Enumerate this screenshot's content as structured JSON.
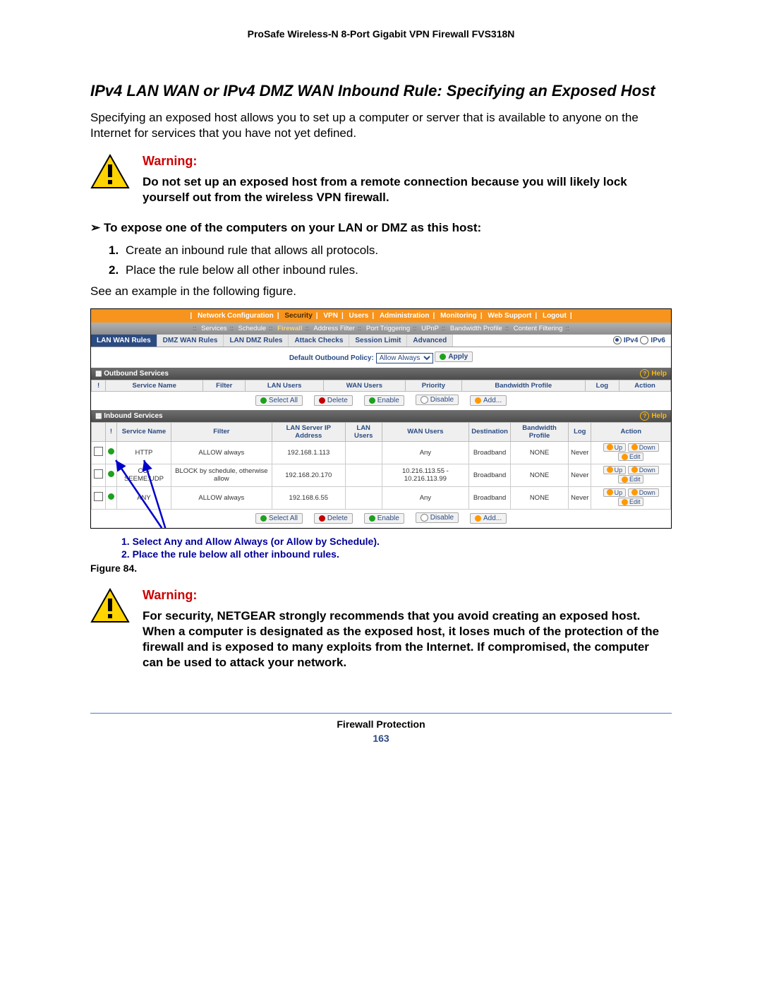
{
  "doc_header": "ProSafe Wireless-N 8-Port Gigabit VPN Firewall FVS318N",
  "section_title": "IPv4 LAN WAN or IPv4 DMZ WAN Inbound Rule: Specifying an Exposed Host",
  "intro": "Specifying an exposed host allows you to set up a computer or server that is available to anyone on the Internet for services that you have not yet defined.",
  "warning_label": "Warning:",
  "warning1_body": "Do not set up an exposed host from a remote connection because you will likely lock yourself out from the wireless VPN firewall.",
  "procedure_head": "➢  To expose one of the computers on your LAN or DMZ as this host:",
  "steps": {
    "s1": "Create an inbound rule that allows all protocols.",
    "s2": "Place the rule below all other inbound rules."
  },
  "see_line": "See an example in the following figure.",
  "top_nav": {
    "items": [
      "Network Configuration",
      "Security",
      "VPN",
      "Users",
      "Administration",
      "Monitoring",
      "Web Support",
      "Logout"
    ],
    "active": "Security"
  },
  "sub_nav": {
    "items": [
      "Services",
      "Schedule",
      "Firewall",
      "Address Filter",
      "Port Triggering",
      "UPnP",
      "Bandwidth Profile",
      "Content Filtering"
    ],
    "active": "Firewall"
  },
  "tabs": {
    "items": [
      "LAN WAN Rules",
      "DMZ WAN Rules",
      "LAN DMZ Rules",
      "Attack Checks",
      "Session Limit",
      "Advanced"
    ],
    "active": "LAN WAN Rules"
  },
  "ip_mode": {
    "v4": "IPv4",
    "v6": "IPv6"
  },
  "policy_row": {
    "label": "Default Outbound Policy:",
    "value": "Allow Always",
    "apply": "Apply"
  },
  "outbound": {
    "title": "Outbound Services",
    "help": "Help",
    "cols": [
      "!",
      "Service Name",
      "Filter",
      "LAN Users",
      "WAN Users",
      "Priority",
      "Bandwidth Profile",
      "Log",
      "Action"
    ]
  },
  "inbound": {
    "title": "Inbound Services",
    "help": "Help",
    "cols": [
      "",
      "!",
      "Service Name",
      "Filter",
      "LAN Server IP Address",
      "LAN Users",
      "WAN Users",
      "Destination",
      "Bandwidth Profile",
      "Log",
      "Action"
    ],
    "rows": [
      {
        "svc": "HTTP",
        "filter": "ALLOW always",
        "lan_ip": "192.168.1.113",
        "lan_users": "",
        "wan": "Any",
        "dest": "Broadband",
        "bw": "NONE",
        "log": "Never"
      },
      {
        "svc": "CU-SEEME:UDP",
        "filter": "BLOCK by schedule, otherwise allow",
        "lan_ip": "192.168.20.170",
        "lan_users": "",
        "wan": "10.216.113.55 - 10.216.113.99",
        "dest": "Broadband",
        "bw": "NONE",
        "log": "Never"
      },
      {
        "svc": "ANY",
        "filter": "ALLOW always",
        "lan_ip": "192.168.6.55",
        "lan_users": "",
        "wan": "Any",
        "dest": "Broadband",
        "bw": "NONE",
        "log": "Never"
      }
    ]
  },
  "action_buttons": {
    "select_all": "Select All",
    "delete": "Delete",
    "enable": "Enable",
    "disable": "Disable",
    "add": "Add...",
    "up": "Up",
    "down": "Down",
    "edit": "Edit"
  },
  "callouts": {
    "c1": "1. Select Any and Allow Always (or Allow by Schedule).",
    "c2": "2. Place the rule below all other inbound rules."
  },
  "figure_label": "Figure 84.",
  "warning2_body": "For security, NETGEAR strongly recommends that you avoid creating an exposed host. When a computer is designated as the exposed host, it loses much of the protection of the firewall and is exposed to many exploits from the Internet. If compromised, the computer can be used to attack your network.",
  "footer": {
    "title": "Firewall Protection",
    "page": "163"
  }
}
